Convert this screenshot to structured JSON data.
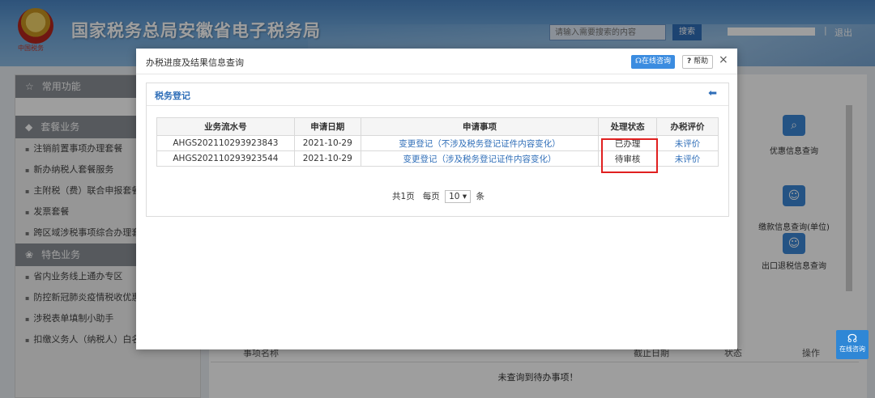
{
  "header": {
    "title": "国家税务总局安徽省电子税务局",
    "emblem_text": "中国税务",
    "search_placeholder": "请输入需要搜索的内容",
    "search_label": "搜索",
    "separator": "|",
    "logout_label": "退出"
  },
  "sidebar": {
    "common_label": "常用功能",
    "package_label": "套餐业务",
    "package_items": [
      "注销前置事项办理套餐",
      "新办纳税人套餐服务",
      "主附税（费）联合申报套餐",
      "发票套餐",
      "跨区域涉税事项综合办理套"
    ],
    "special_label": "特色业务",
    "special_items": [
      "省内业务线上通办专区",
      "防控新冠肺炎疫情税收优惠",
      "涉税表单填制小助手",
      "扣缴义务人（纳税人）白名单申请"
    ]
  },
  "background": {
    "quick_items": [
      "优惠信息查询",
      "缴款信息查询(单位)\n(新版)",
      "出口退税信息查询"
    ],
    "table_cols": [
      "事项名称",
      "截止日期",
      "状态",
      "操作"
    ],
    "empty_text": "未查询到待办事项！"
  },
  "modal": {
    "title": "办税进度及结果信息查询",
    "online_label": "在线咨询",
    "help_label": "帮助",
    "close_label": "×",
    "panel_title": "税务登记",
    "columns": [
      "业务流水号",
      "申请日期",
      "申请事项",
      "处理状态",
      "办税评价"
    ],
    "rows": [
      [
        "AHGS202110293923843",
        "2021-10-29",
        "变更登记（不涉及税务登记证件内容变化）",
        "已办理",
        "未评价"
      ],
      [
        "AHGS202110293923544",
        "2021-10-29",
        "变更登记（涉及税务登记证件内容变化）",
        "待审核",
        "未评价"
      ]
    ],
    "pager": {
      "total_label": "共1页",
      "per_page_label": "每页",
      "per_page_value": "10",
      "unit_label": "条"
    }
  },
  "float_help": {
    "label": "在线咨询"
  },
  "colors": {
    "brand_blue": "#2f6eb8",
    "highlight_red": "#e02020"
  }
}
